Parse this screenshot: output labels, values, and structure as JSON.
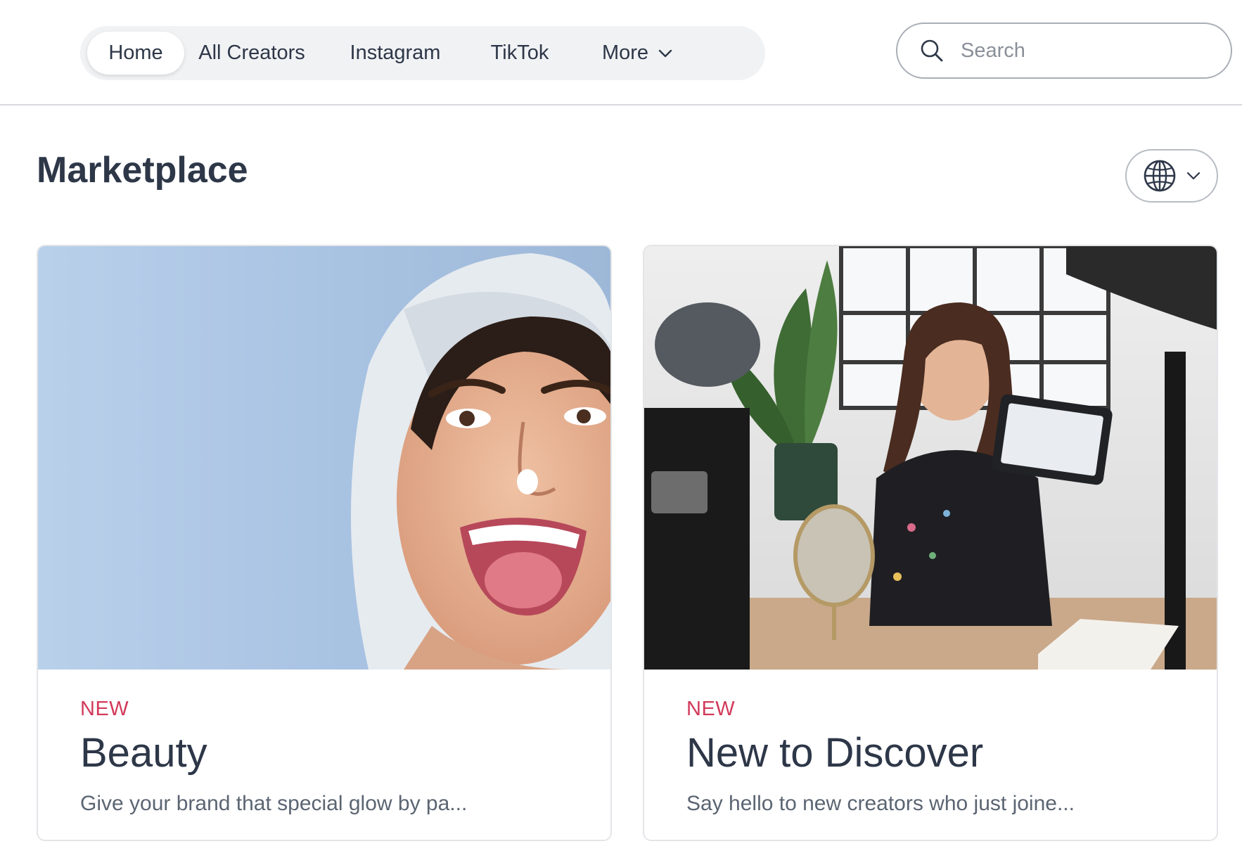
{
  "nav": {
    "items": [
      {
        "label": "Home",
        "active": true
      },
      {
        "label": "All Creators",
        "active": false
      },
      {
        "label": "Instagram",
        "active": false
      },
      {
        "label": "TikTok",
        "active": false
      },
      {
        "label": "More",
        "active": false
      }
    ]
  },
  "search": {
    "placeholder": "Search",
    "value": ""
  },
  "page": {
    "title": "Marketplace"
  },
  "locale": {
    "icon": "globe-icon",
    "chevron": "chevron-down-icon"
  },
  "cards": [
    {
      "badge": "NEW",
      "title": "Beauty",
      "description": "Give your brand that special glow by pa...",
      "image": "woman-with-towel-and-face-cream-photo"
    },
    {
      "badge": "NEW",
      "title": "New to Discover",
      "description": "Say hello to new creators who just joine...",
      "image": "creator-filming-with-tablet-photo"
    }
  ],
  "colors": {
    "accent_badge": "#d23a5a",
    "text": "#2d3748",
    "muted": "#5b6572",
    "nav_bg": "#f1f2f4"
  }
}
